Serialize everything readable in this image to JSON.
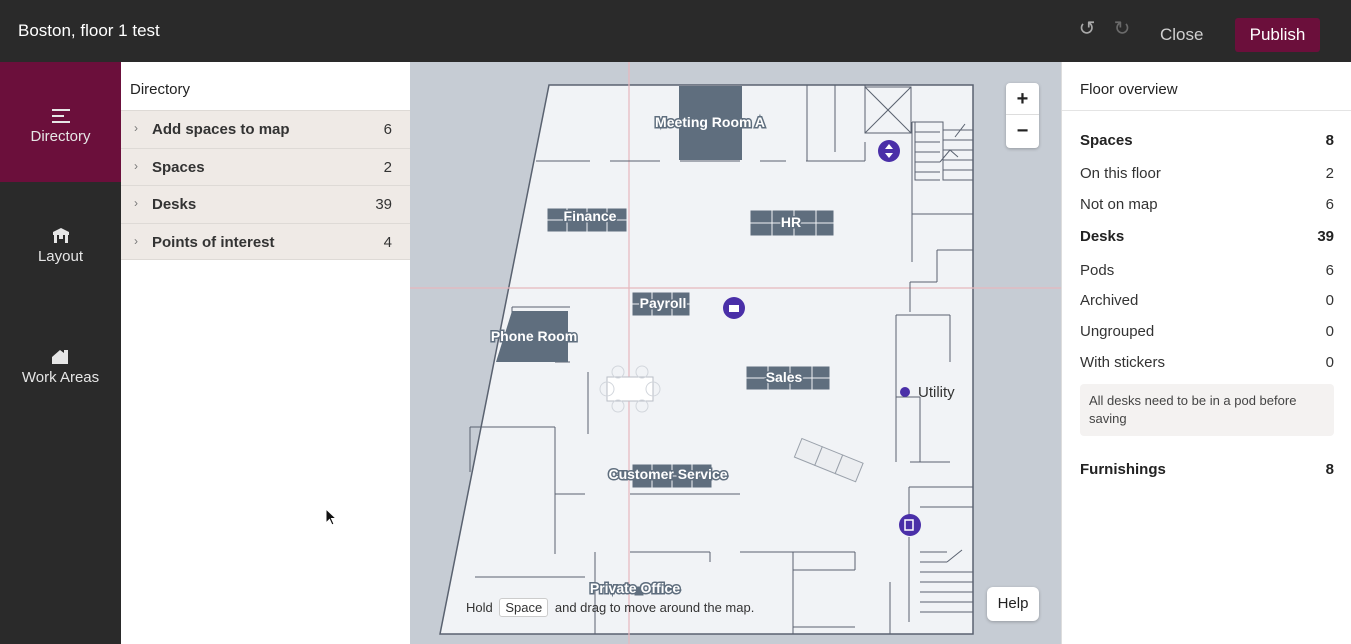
{
  "header": {
    "title": "Boston, floor 1 test",
    "close_label": "Close",
    "publish_label": "Publish",
    "undo_icon": "undo-icon",
    "redo_icon": "redo-icon",
    "publish_color": "#6b0f3b"
  },
  "rail": {
    "items": [
      {
        "label": "Directory",
        "icon": "list-icon"
      },
      {
        "label": "Layout",
        "icon": "chair-icon"
      },
      {
        "label": "Work Areas",
        "icon": "house-icon"
      }
    ],
    "active_color": "#6b0f3b"
  },
  "directory": {
    "title": "Directory",
    "rows": [
      {
        "label": "Add spaces to map",
        "count": "6"
      },
      {
        "label": "Spaces",
        "count": "2"
      },
      {
        "label": "Desks",
        "count": "39"
      },
      {
        "label": "Points of interest",
        "count": "4"
      }
    ]
  },
  "map": {
    "labels": {
      "meeting_room": "Meeting Room A",
      "finance": "Finance",
      "hr": "HR",
      "payroll": "Payroll",
      "phone_room": "Phone Room",
      "sales": "Sales",
      "utility": "Utility",
      "customer_service": "Customer Service",
      "private_office": "Private Office"
    },
    "hint": {
      "before": "Hold",
      "key": "Space",
      "after": "and drag to move around the map."
    },
    "help_label": "Help",
    "zoom_in": "+",
    "zoom_out": "−"
  },
  "overview": {
    "title": "Floor overview",
    "spaces": {
      "label": "Spaces",
      "value": "8"
    },
    "on_floor": {
      "label": "On this floor",
      "value": "2"
    },
    "not_on_map": {
      "label": "Not on map",
      "value": "6"
    },
    "desks": {
      "label": "Desks",
      "value": "39"
    },
    "pods": {
      "label": "Pods",
      "value": "6"
    },
    "archived": {
      "label": "Archived",
      "value": "0"
    },
    "ungrouped": {
      "label": "Ungrouped",
      "value": "0"
    },
    "with_stickers": {
      "label": "With stickers",
      "value": "0"
    },
    "note": "All desks need to be in a pod before saving",
    "furnishings": {
      "label": "Furnishings",
      "value": "8"
    }
  }
}
